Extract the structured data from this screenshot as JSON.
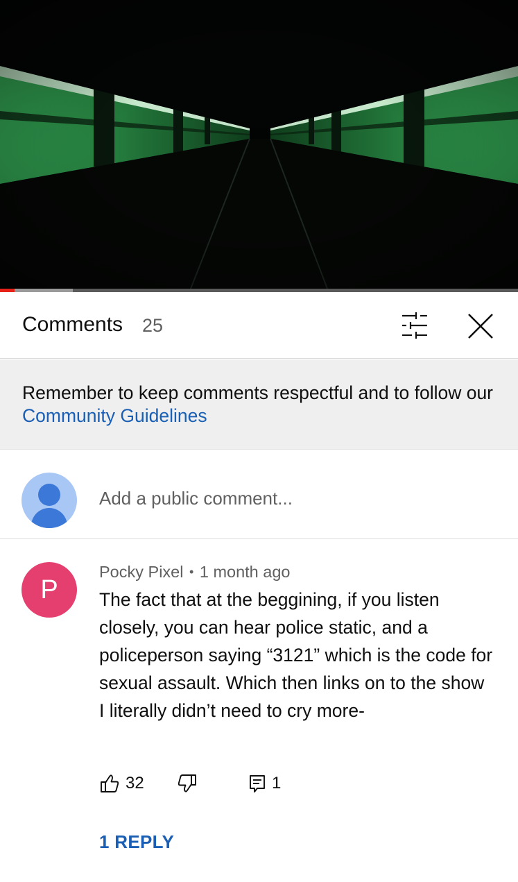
{
  "video": {
    "progress": {
      "played_fraction": 0.028,
      "buffered_fraction": 0.14
    }
  },
  "comments_header": {
    "title": "Comments",
    "count": "25"
  },
  "notice": {
    "text": "Remember to keep comments respectful and to follow our ",
    "link": "Community Guidelines"
  },
  "add_comment": {
    "placeholder": "Add a public comment..."
  },
  "comment": {
    "avatar_letter": "P",
    "author": "Pocky Pixel",
    "separator": "•",
    "time": "1 month ago",
    "text_lines": [
      "The fact that at the beggining, if you listen closely, you can hear police static, and a policeperson saying “3121” which is the code for sexual assault. Which then links on to the show",
      "I literally didn’t need to cry more-"
    ],
    "likes": "32",
    "replies_count": "1",
    "reply_link": "1 REPLY"
  },
  "colors": {
    "accent_link": "#1a5fb4",
    "avatar_letter_bg": "#e53f6f",
    "avatar_user_bg": "#a8c7f5",
    "progress_played": "#e62117"
  },
  "icons": [
    "filter-icon",
    "close-icon",
    "thumbs-up-icon",
    "thumbs-down-icon",
    "reply-icon",
    "default-avatar-icon"
  ]
}
